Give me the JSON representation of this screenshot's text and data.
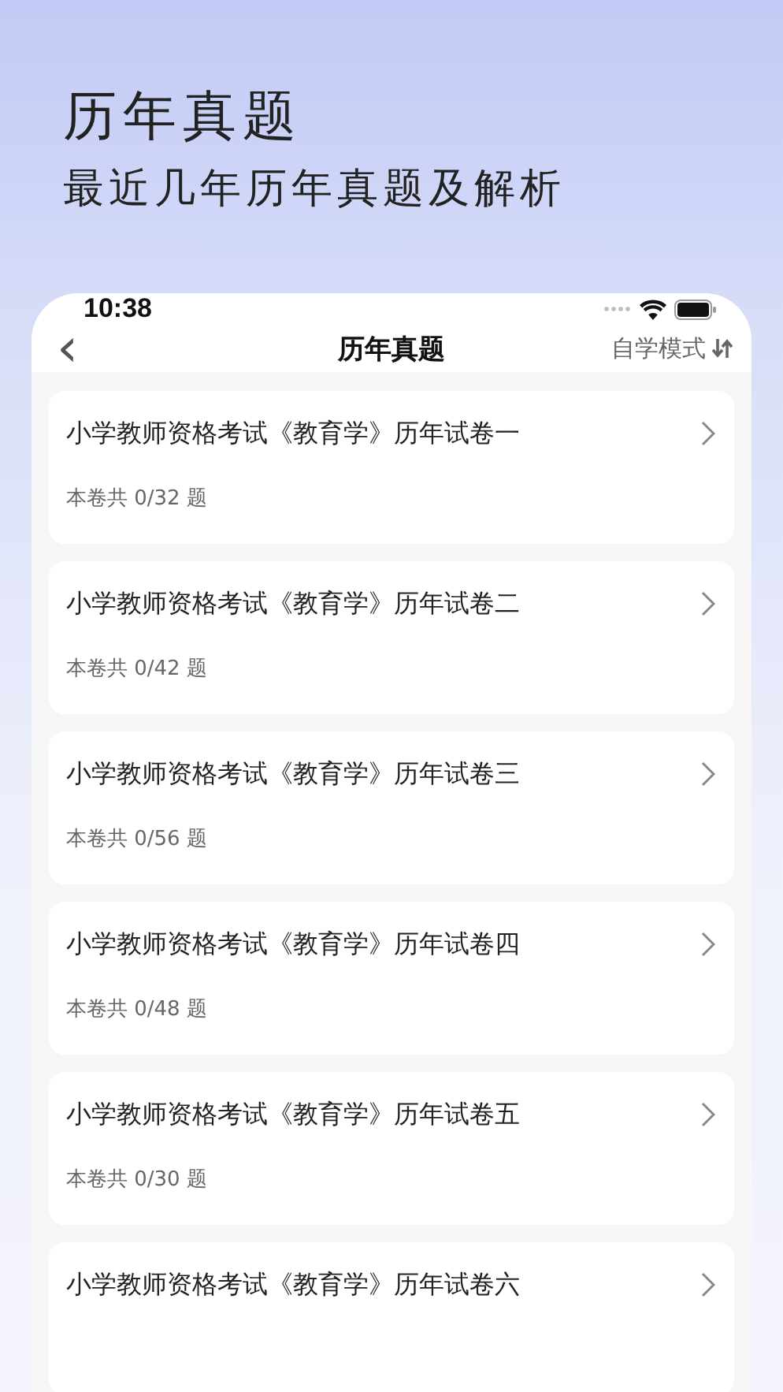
{
  "header": {
    "title": "历年真题",
    "subtitle": "最近几年历年真题及解析"
  },
  "status_bar": {
    "time": "10:38"
  },
  "nav": {
    "back": "‹",
    "title": "历年真题",
    "mode": "自学模式"
  },
  "papers": [
    {
      "title": "小学教师资格考试《教育学》历年试卷一",
      "count": "本卷共 0/32 题"
    },
    {
      "title": "小学教师资格考试《教育学》历年试卷二",
      "count": "本卷共 0/42 题"
    },
    {
      "title": "小学教师资格考试《教育学》历年试卷三",
      "count": "本卷共 0/56 题"
    },
    {
      "title": "小学教师资格考试《教育学》历年试卷四",
      "count": "本卷共 0/48 题"
    },
    {
      "title": "小学教师资格考试《教育学》历年试卷五",
      "count": "本卷共 0/30 题"
    },
    {
      "title": "小学教师资格考试《教育学》历年试卷六"
    }
  ]
}
